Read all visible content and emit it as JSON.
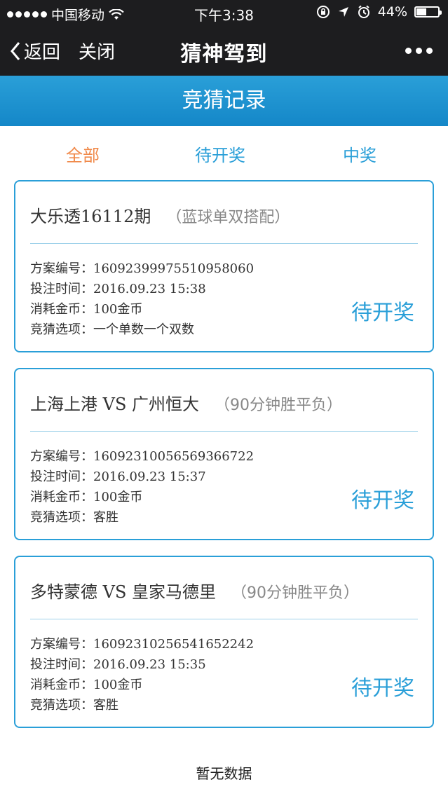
{
  "status_bar": {
    "carrier": "中国移动",
    "time": "下午3:38",
    "battery": "44%",
    "battery_level": 0.44
  },
  "nav": {
    "back_label": "返回",
    "close_label": "关闭",
    "title": "猜神驾到"
  },
  "header": {
    "title": "竞猜记录"
  },
  "tabs": [
    {
      "label": "全部",
      "active": true
    },
    {
      "label": "待开奖",
      "active": false
    },
    {
      "label": "中奖",
      "active": false
    }
  ],
  "records": [
    {
      "title": "大乐透16112期",
      "subtitle": "（蓝球单双搭配）",
      "scheme_label": "方案编号：",
      "scheme_no": "16092399975510958060",
      "time_label": "投注时间：",
      "time": "2016.09.23 15:38",
      "cost_label": "消耗金币：",
      "cost": "100金币",
      "option_label": "竞猜选项：",
      "option": "一个单数一个双数",
      "status": "待开奖"
    },
    {
      "title": "上海上港 VS 广州恒大",
      "subtitle": "（90分钟胜平负）",
      "scheme_label": "方案编号：",
      "scheme_no": "16092310056569366722",
      "time_label": "投注时间：",
      "time": "2016.09.23 15:37",
      "cost_label": "消耗金币：",
      "cost": "100金币",
      "option_label": "竞猜选项：",
      "option": "客胜",
      "status": "待开奖"
    },
    {
      "title": "多特蒙德 VS 皇家马德里",
      "subtitle": "（90分钟胜平负）",
      "scheme_label": "方案编号：",
      "scheme_no": "16092310256541652242",
      "time_label": "投注时间：",
      "time": "2016.09.23 15:35",
      "cost_label": "消耗金币：",
      "cost": "100金币",
      "option_label": "竞猜选项：",
      "option": "客胜",
      "status": "待开奖"
    }
  ],
  "empty_text": "暂无数据",
  "colors": {
    "accent": "#2a9fd8",
    "active_tab": "#f08a4b",
    "bar": "#1d1d1f"
  }
}
